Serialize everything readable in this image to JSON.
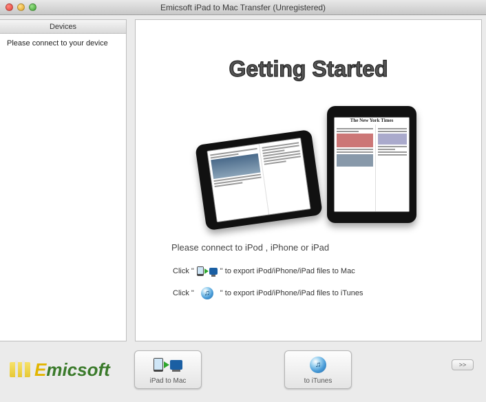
{
  "window": {
    "title": "Emicsoft iPad to Mac Transfer (Unregistered)"
  },
  "sidebar": {
    "header": "Devices",
    "message": "Please connect to your device"
  },
  "main": {
    "heading": "Getting Started",
    "connect_prompt": "Please connect to iPod , iPhone or iPad",
    "line1_pre": "Click \"",
    "line1_post": "\" to export iPod/iPhone/iPad files to Mac",
    "line2_pre": "Click \"",
    "line2_post": "\" to export iPod/iPhone/iPad files to iTunes",
    "ipad2_headline": "The New York Times"
  },
  "footer": {
    "logo_first": "E",
    "logo_rest": "micsoft",
    "btn1_label": "iPad to Mac",
    "btn2_label": "to iTunes",
    "more_label": ">>"
  }
}
